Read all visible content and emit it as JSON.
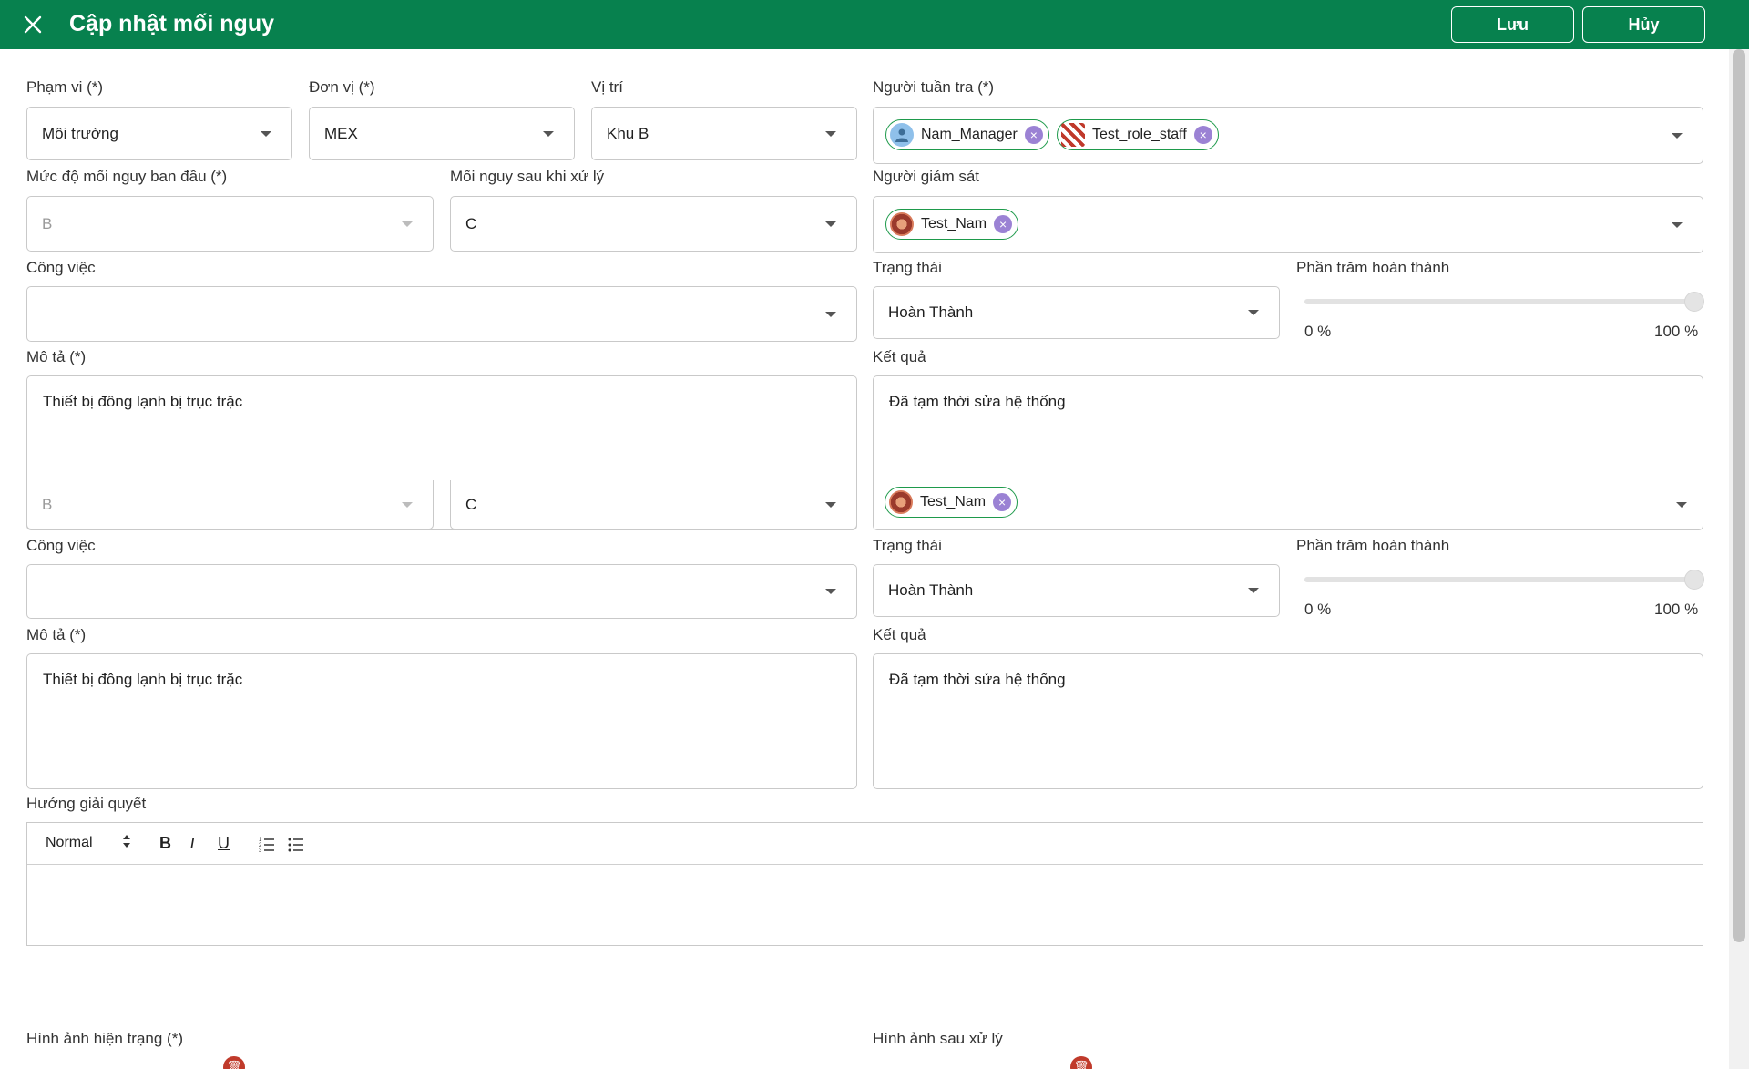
{
  "header": {
    "title": "Cập nhật mối nguy",
    "save_label": "Lưu",
    "cancel_label": "Hủy",
    "colors": {
      "bar": "#07814e",
      "chip_border": "#1e9a4b",
      "chip_remove": "#9b82d4"
    }
  },
  "form": {
    "scope": {
      "label": "Phạm vi (*)",
      "value": "Môi trường"
    },
    "unit": {
      "label": "Đơn vị (*)",
      "value": "MEX"
    },
    "location": {
      "label": "Vị trí",
      "value": "Khu B"
    },
    "patrollers": {
      "label": "Người tuần tra (*)",
      "chips": [
        "Nam_Manager",
        "Test_role_staff"
      ]
    },
    "initial_level": {
      "label": "Mức độ mối nguy ban đầu (*)",
      "value": "B"
    },
    "after_level": {
      "label": "Mối nguy sau khi xử lý",
      "value": "C"
    },
    "supervisor": {
      "label": "Người giám sát",
      "chips": [
        "Test_Nam"
      ]
    },
    "task": {
      "label": "Công việc",
      "value": ""
    },
    "status": {
      "label": "Trạng thái",
      "value": "Hoàn Thành"
    },
    "percent": {
      "label": "Phần trăm hoàn thành",
      "min_label": "0 %",
      "max_label": "100 %",
      "value": 100
    },
    "description": {
      "label": "Mô tả (*)",
      "value": "Thiết bị đông lạnh bị trục trặc"
    },
    "result": {
      "label": "Kết quả",
      "value": "Đã tạm thời sửa hệ thống"
    },
    "solution": {
      "label": "Hướng giải quyết",
      "format": "Normal",
      "bold": "B",
      "italic": "I",
      "underline": "U"
    },
    "image_current": {
      "label": "Hình ảnh hiện trạng (*)"
    },
    "image_after": {
      "label": "Hình ảnh sau xử lý"
    }
  }
}
